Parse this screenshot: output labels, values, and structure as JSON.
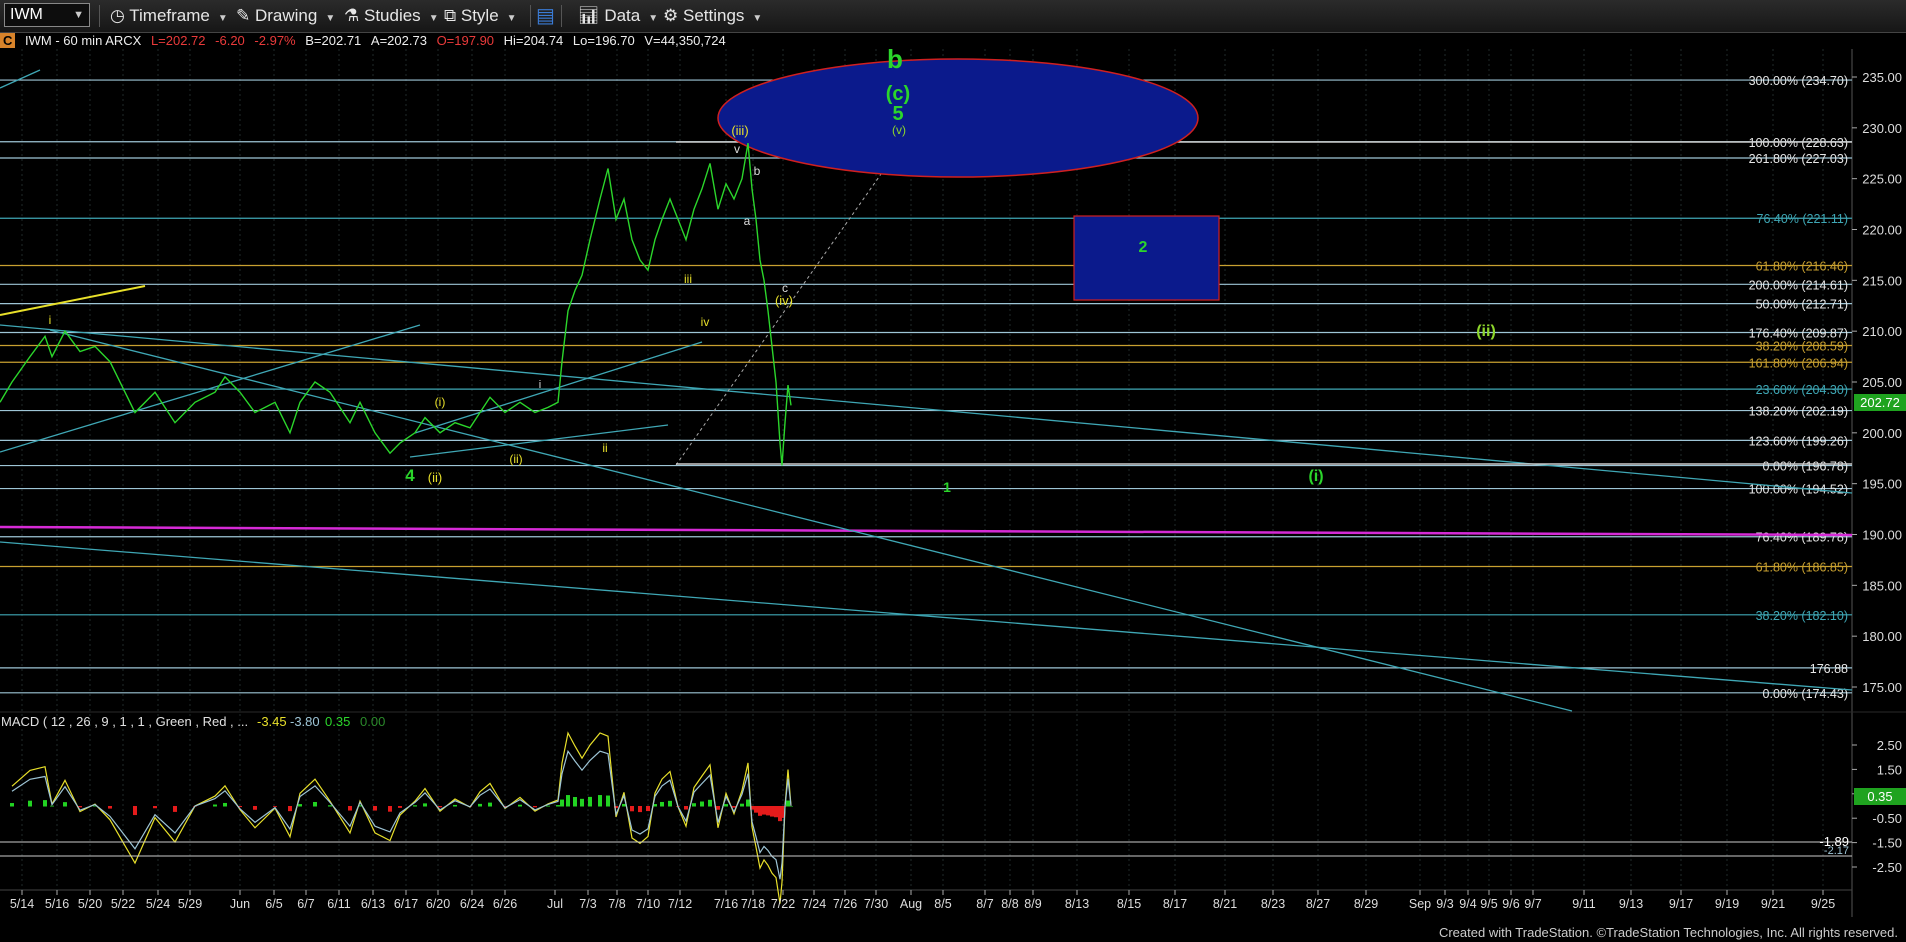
{
  "toolbar": {
    "symbol": "IWM",
    "timeframe": "Timeframe",
    "drawing": "Drawing",
    "studies": "Studies",
    "style": "Style",
    "data": "Data",
    "settings": "Settings"
  },
  "infobar": {
    "badge": "C",
    "symbol_desc": "IWM - 60 min  ARCX",
    "last": "L=202.72",
    "change": "-6.20",
    "change_pct": "-2.97%",
    "bid": "B=202.71",
    "ask": "A=202.73",
    "open": "O=197.90",
    "high": "Hi=204.74",
    "low": "Lo=196.70",
    "volume": "V=44,350,724"
  },
  "macd": {
    "label": "MACD ( 12 , 26 , 9 , 1 , 1 , Green , Red , ...",
    "v1": "-3.45",
    "v2": "-3.80",
    "v3": "0.35",
    "v4": "0.00",
    "current_tag": "0.35",
    "tag_a": "-1.89",
    "tag_b": "-2.17"
  },
  "footer": "Created with TradeStation. ©TradeStation Technologies, Inc. All rights reserved.",
  "colors": {
    "price": "#2bd62b",
    "fib_line": "#9ec5d6",
    "teal_line": "#3fa7b5",
    "yellow": "#e8e02a",
    "magenta": "#d62ad6",
    "box_fill": "#0b1a8c",
    "box_border": "#d02020",
    "macd_up": "#22d322",
    "macd_down": "#e51b1b"
  },
  "chart_data": {
    "type": "line",
    "title": "IWM - 60 min",
    "price_axis": {
      "ticks": [
        "235.00",
        "230.00",
        "225.00",
        "220.00",
        "215.00",
        "210.00",
        "205.00",
        "200.00",
        "195.00",
        "190.00",
        "185.00",
        "180.00",
        "175.00"
      ],
      "range": [
        172.5,
        237.5
      ]
    },
    "macd_axis": {
      "ticks": [
        "2.50",
        "1.50",
        "0.50",
        "-0.50",
        "-1.50",
        "-2.50"
      ]
    },
    "x_labels": [
      "5/14",
      "5/16",
      "5/20",
      "5/22",
      "5/24",
      "5/29",
      "Jun",
      "6/5",
      "6/7",
      "6/11",
      "6/13",
      "6/17",
      "6/20",
      "6/24",
      "6/26",
      "Jul",
      "7/3",
      "7/8",
      "7/10",
      "7/12",
      "7/16",
      "7/18",
      "7/22",
      "7/24",
      "7/26",
      "7/30",
      "Aug",
      "8/5",
      "8/7",
      "8/8",
      "8/9",
      "8/13",
      "8/15",
      "8/17",
      "8/21",
      "8/23",
      "8/27",
      "8/29",
      "Sep",
      "9/3",
      "9/4",
      "9/5",
      "9/6",
      "9/7",
      "9/11",
      "9/13",
      "9/17",
      "9/19",
      "9/21",
      "9/25"
    ],
    "current_price": "202.72",
    "price_path": [
      [
        0,
        203
      ],
      [
        12,
        205
      ],
      [
        30,
        207.5
      ],
      [
        45,
        209.5
      ],
      [
        52,
        207.5
      ],
      [
        65,
        210
      ],
      [
        80,
        208
      ],
      [
        95,
        208.5
      ],
      [
        110,
        207
      ],
      [
        135,
        202
      ],
      [
        155,
        204
      ],
      [
        175,
        201
      ],
      [
        195,
        203
      ],
      [
        215,
        204
      ],
      [
        225,
        205.5
      ],
      [
        240,
        204
      ],
      [
        255,
        202
      ],
      [
        275,
        203
      ],
      [
        290,
        200
      ],
      [
        300,
        203
      ],
      [
        315,
        205
      ],
      [
        330,
        204
      ],
      [
        350,
        201
      ],
      [
        360,
        203
      ],
      [
        375,
        200
      ],
      [
        390,
        198
      ],
      [
        400,
        199
      ],
      [
        415,
        200
      ],
      [
        425,
        201.5
      ],
      [
        440,
        200
      ],
      [
        455,
        201
      ],
      [
        470,
        200.5
      ],
      [
        480,
        202
      ],
      [
        490,
        203.5
      ],
      [
        505,
        202
      ],
      [
        520,
        203
      ],
      [
        535,
        202
      ],
      [
        548,
        202.5
      ],
      [
        558,
        203
      ],
      [
        562,
        207
      ],
      [
        568,
        212
      ],
      [
        575,
        214
      ],
      [
        582,
        215.5
      ],
      [
        590,
        219
      ],
      [
        600,
        223
      ],
      [
        608,
        226
      ],
      [
        616,
        221
      ],
      [
        624,
        223
      ],
      [
        632,
        219
      ],
      [
        640,
        217
      ],
      [
        648,
        216
      ],
      [
        655,
        219
      ],
      [
        662,
        221
      ],
      [
        670,
        223
      ],
      [
        678,
        221
      ],
      [
        686,
        219
      ],
      [
        694,
        222
      ],
      [
        702,
        224
      ],
      [
        710,
        226.5
      ],
      [
        718,
        222
      ],
      [
        726,
        224.5
      ],
      [
        734,
        223
      ],
      [
        742,
        225
      ],
      [
        748,
        228.5
      ],
      [
        752,
        224
      ],
      [
        756,
        221
      ],
      [
        760,
        217
      ],
      [
        764,
        215
      ],
      [
        768,
        212
      ],
      [
        772,
        208.5
      ],
      [
        776,
        205
      ],
      [
        780,
        199
      ],
      [
        782,
        196.8
      ],
      [
        785,
        201
      ],
      [
        788,
        204.7
      ],
      [
        791,
        202.7
      ]
    ],
    "fib_levels": [
      {
        "label": "300.00% (234.70)",
        "value": 234.7
      },
      {
        "label": "100.00% (228.63)",
        "value": 228.63
      },
      {
        "label": "261.80% (227.03)",
        "value": 227.03
      },
      {
        "label": "76.40% (221.11)",
        "value": 221.11
      },
      {
        "label": "61.80% (216.46)",
        "value": 216.46
      },
      {
        "label": "200.00% (214.61)",
        "value": 214.61
      },
      {
        "label": "50.00% (212.71)",
        "value": 212.71
      },
      {
        "label": "176.40% (209.87)",
        "value": 209.87
      },
      {
        "label": "38.20% (208.59)",
        "value": 208.59
      },
      {
        "label": "161.80% (206.94)",
        "value": 206.94
      },
      {
        "label": "23.60% (204.30)",
        "value": 204.3
      },
      {
        "label": "138.20% (202.19)",
        "value": 202.19
      },
      {
        "label": "123.60% (199.26)",
        "value": 199.26
      },
      {
        "label": "0.00% (196.78)",
        "value": 196.78
      },
      {
        "label": "100.00% (194.52)",
        "value": 194.52
      },
      {
        "label": "76.40% (189.78)",
        "value": 189.78
      },
      {
        "label": "61.80% (186.85)",
        "value": 186.85
      },
      {
        "label": "38.20% (182.10)",
        "value": 182.1
      },
      {
        "label": "176.88",
        "value": 176.88
      },
      {
        "label": "0.00% (174.43)",
        "value": 174.43
      }
    ],
    "wave_labels": [
      "b",
      "(c)",
      "5",
      "(v)",
      "(iii)",
      "v",
      "b",
      "a",
      "c",
      "(iv)",
      "iii",
      "iv",
      "i",
      "(i)",
      "(ii)",
      "i",
      "ii",
      "(ii)",
      "4",
      "(i)",
      "1",
      "2",
      "(ii)"
    ]
  }
}
